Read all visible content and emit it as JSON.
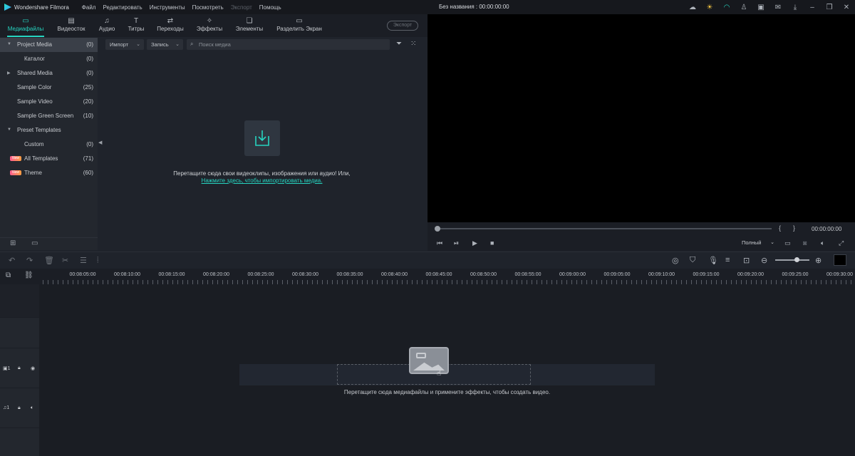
{
  "titlebar": {
    "app_name": "Wondershare Filmora",
    "menu": [
      "Файл",
      "Редактировать",
      "Инструменты",
      "Посмотреть",
      "Экспорт",
      "Помощь"
    ],
    "project_title": "Без названия : 00:00:00:00"
  },
  "tabs": [
    {
      "label": "Медиафайлы",
      "icon": "folder-icon",
      "active": true
    },
    {
      "label": "Видеосток",
      "icon": "film-icon"
    },
    {
      "label": "Аудио",
      "icon": "music-note-icon"
    },
    {
      "label": "Титры",
      "icon": "text-icon"
    },
    {
      "label": "Переходы",
      "icon": "transitions-icon"
    },
    {
      "label": "Эффекты",
      "icon": "effects-icon"
    },
    {
      "label": "Элементы",
      "icon": "elements-icon"
    },
    {
      "label": "Разделить Экран",
      "icon": "split-screen-icon"
    }
  ],
  "export_button": "Экспорт",
  "library": [
    {
      "name": "Project Media",
      "count": "(0)",
      "expanded": true,
      "selected": true
    },
    {
      "name": "Каталог",
      "count": "(0)",
      "child": true
    },
    {
      "name": "Shared Media",
      "count": "(0)",
      "collapsed": true
    },
    {
      "name": "Sample Color",
      "count": "(25)"
    },
    {
      "name": "Sample Video",
      "count": "(20)"
    },
    {
      "name": "Sample Green Screen",
      "count": "(10)"
    },
    {
      "name": "Preset Templates",
      "count": "",
      "expanded": true
    },
    {
      "name": "Custom",
      "count": "(0)",
      "child": true
    },
    {
      "name": "All Templates",
      "count": "(71)",
      "badge": "New"
    },
    {
      "name": "Theme",
      "count": "(60)",
      "badge": "New"
    }
  ],
  "media_toolbar": {
    "import_label": "Импорт",
    "record_label": "Запись",
    "search_placeholder": "Поиск медиа"
  },
  "media_empty": {
    "line1": "Перетащите сюда свои видеоклипы, изображения или аудио! Или,",
    "link": "Нажмите здесь, чтобы импортировать медиа."
  },
  "preview": {
    "time": "00:00:00:00",
    "quality": "Полный",
    "bracket_in": "{",
    "bracket_out": "}"
  },
  "ruler_labels": [
    "00:08:05:00",
    "00:08:10:00",
    "00:08:15:00",
    "00:08:20:00",
    "00:08:25:00",
    "00:08:30:00",
    "00:08:35:00",
    "00:08:40:00",
    "00:08:45:00",
    "00:08:50:00",
    "00:08:55:00",
    "00:09:00:00",
    "00:09:05:00",
    "00:09:10:00",
    "00:09:15:00",
    "00:09:20:00",
    "00:09:25:00",
    "00:09:30:00"
  ],
  "tracks": {
    "video_label": "1",
    "audio_label": "1"
  },
  "timeline_hint": "Перетащите сюда медиафайлы и примените эффекты, чтобы создать видео."
}
